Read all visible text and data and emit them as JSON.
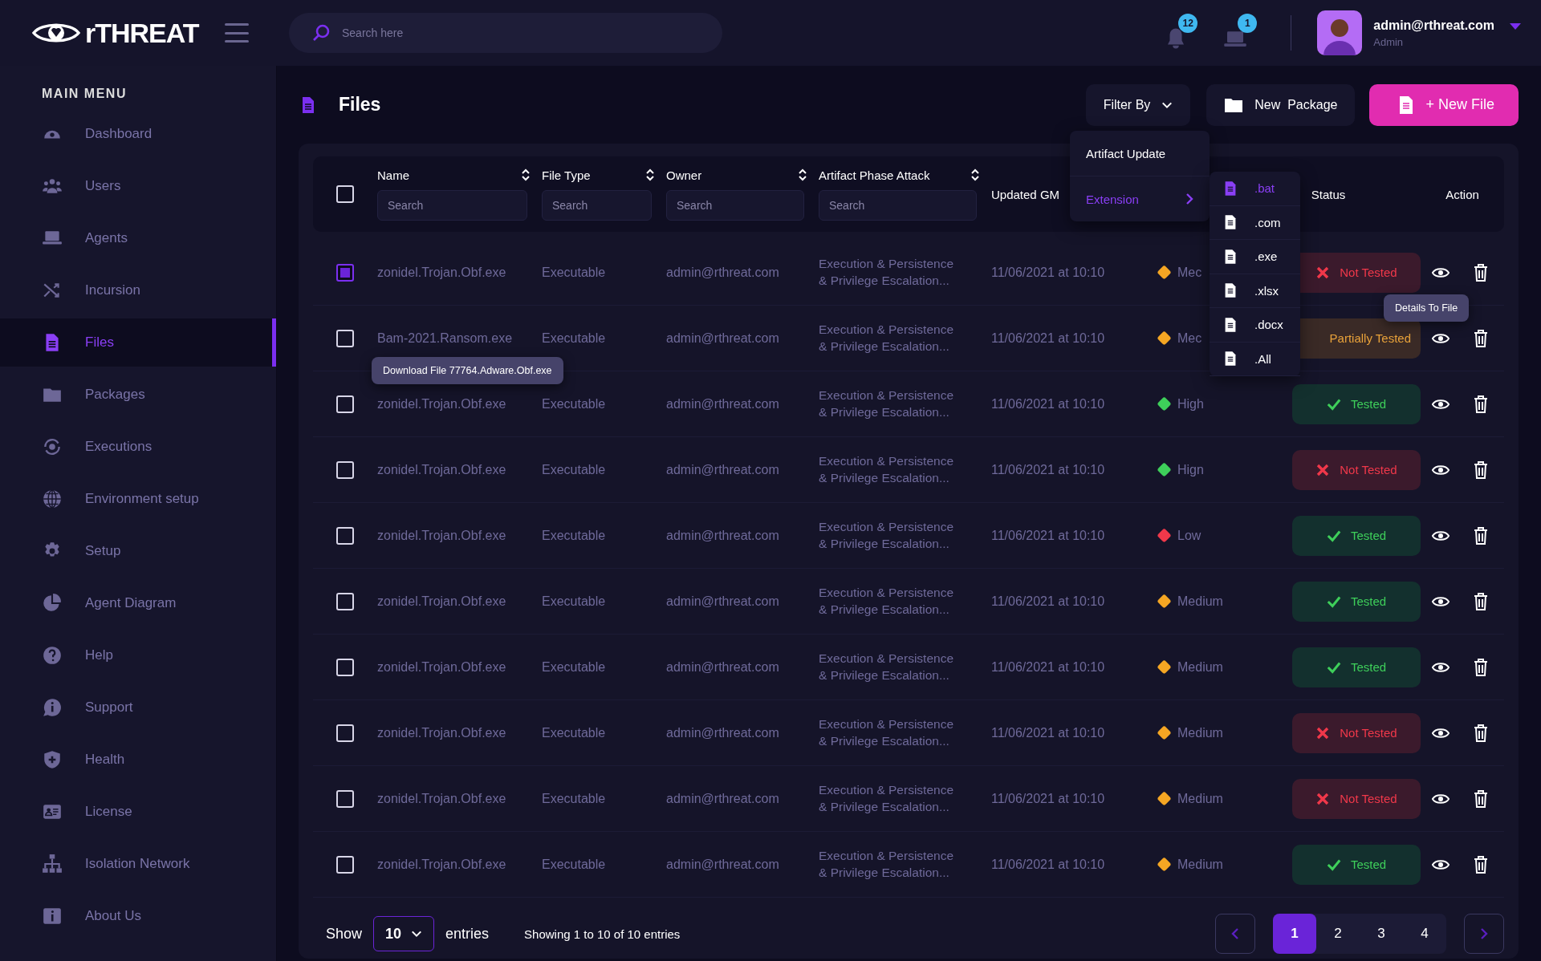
{
  "header": {
    "logo": "rTHREAT",
    "search_placeholder": "Search here",
    "badges": [
      {
        "count": "12"
      },
      {
        "count": "1"
      }
    ],
    "user": {
      "email": "admin@rthreat.com",
      "role": "Admin"
    }
  },
  "sidebar": {
    "title": "MAIN MENU",
    "items": [
      {
        "label": "Dashboard",
        "selected": false
      },
      {
        "label": "Users",
        "selected": false
      },
      {
        "label": "Agents",
        "selected": false
      },
      {
        "label": "Incursion",
        "selected": false
      },
      {
        "label": "Files",
        "selected": true
      },
      {
        "label": "Packages",
        "selected": false
      },
      {
        "label": "Executions",
        "selected": false
      },
      {
        "label": "Environment setup",
        "selected": false
      },
      {
        "label": "Setup",
        "selected": false
      },
      {
        "label": "Agent Diagram",
        "selected": false
      },
      {
        "label": "Help",
        "selected": false
      },
      {
        "label": "Support",
        "selected": false
      },
      {
        "label": "Health",
        "selected": false
      },
      {
        "label": "License",
        "selected": false
      },
      {
        "label": "Isolation Network",
        "selected": false
      },
      {
        "label": "About Us",
        "selected": false
      }
    ]
  },
  "page": {
    "title": "Files",
    "filter_button": "Filter By",
    "new_package_button": "New  Package",
    "new_file_button": "+ New File"
  },
  "filter_menu": {
    "items": [
      {
        "label": "Artifact Update",
        "selected": false
      },
      {
        "label": "Extension",
        "selected": true
      }
    ]
  },
  "extension_menu": {
    "items": [
      {
        "label": ".bat",
        "selected": true
      },
      {
        "label": ".com",
        "selected": false
      },
      {
        "label": ".exe",
        "selected": false
      },
      {
        "label": ".xlsx",
        "selected": false
      },
      {
        "label": ".docx",
        "selected": false
      },
      {
        "label": ".All",
        "selected": false
      }
    ]
  },
  "table": {
    "select_all_checked": false,
    "columns": [
      {
        "label": "Name",
        "kind": "sortable",
        "search_placeholder": "Search"
      },
      {
        "label": "File Type",
        "kind": "sortable",
        "search_placeholder": "Search"
      },
      {
        "label": "Owner",
        "kind": "sortable",
        "search_placeholder": "Search"
      },
      {
        "label": "Artifact Phase Attack",
        "kind": "sortable",
        "search_placeholder": "Search"
      },
      {
        "label": "Updated GM",
        "kind": "plain"
      },
      {
        "label": "Status",
        "kind": "plain"
      },
      {
        "label": "Action",
        "kind": "plain"
      }
    ],
    "rows": [
      {
        "checked": true,
        "name": "zonidel.Trojan.Obf.exe",
        "file_type": "Executable",
        "owner": "admin@rthreat.com",
        "phase": [
          "Execution & Persistence",
          "& Privilege Escalation..."
        ],
        "updated": "11/06/2021 at 10:10",
        "priority": {
          "label": "Mec",
          "color": "#f5a623"
        },
        "status": {
          "label": "Not Tested",
          "kind": "not_tested"
        }
      },
      {
        "checked": false,
        "name": "Bam-2021.Ransom.exe",
        "file_type": "Executable",
        "owner": "admin@rthreat.com",
        "phase": [
          "Execution & Persistence",
          "& Privilege Escalation..."
        ],
        "updated": "11/06/2021 at 10:10",
        "priority": {
          "label": "Mec",
          "color": "#f5a623"
        },
        "status": {
          "label": "Partially Tested",
          "kind": "partial"
        }
      },
      {
        "checked": false,
        "name": "zonidel.Trojan.Obf.exe",
        "file_type": "Executable",
        "owner": "admin@rthreat.com",
        "phase": [
          "Execution & Persistence",
          "& Privilege Escalation..."
        ],
        "updated": "11/06/2021 at 10:10",
        "priority": {
          "label": "High",
          "color": "#3ecf5a"
        },
        "status": {
          "label": "Tested",
          "kind": "tested"
        }
      },
      {
        "checked": false,
        "name": "zonidel.Trojan.Obf.exe",
        "file_type": "Executable",
        "owner": "admin@rthreat.com",
        "phase": [
          "Execution & Persistence",
          "& Privilege Escalation..."
        ],
        "updated": "11/06/2021 at 10:10",
        "priority": {
          "label": "Hign",
          "color": "#3ecf5a"
        },
        "status": {
          "label": "Not Tested",
          "kind": "not_tested"
        }
      },
      {
        "checked": false,
        "name": "zonidel.Trojan.Obf.exe",
        "file_type": "Executable",
        "owner": "admin@rthreat.com",
        "phase": [
          "Execution & Persistence",
          "& Privilege Escalation..."
        ],
        "updated": "11/06/2021 at 10:10",
        "priority": {
          "label": "Low",
          "color": "#f0384a"
        },
        "status": {
          "label": "Tested",
          "kind": "tested"
        }
      },
      {
        "checked": false,
        "name": "zonidel.Trojan.Obf.exe",
        "file_type": "Executable",
        "owner": "admin@rthreat.com",
        "phase": [
          "Execution & Persistence",
          "& Privilege Escalation..."
        ],
        "updated": "11/06/2021 at 10:10",
        "priority": {
          "label": "Medium",
          "color": "#f5a623"
        },
        "status": {
          "label": "Tested",
          "kind": "tested"
        }
      },
      {
        "checked": false,
        "name": "zonidel.Trojan.Obf.exe",
        "file_type": "Executable",
        "owner": "admin@rthreat.com",
        "phase": [
          "Execution & Persistence",
          "& Privilege Escalation..."
        ],
        "updated": "11/06/2021 at 10:10",
        "priority": {
          "label": "Medium",
          "color": "#f5a623"
        },
        "status": {
          "label": "Tested",
          "kind": "tested"
        }
      },
      {
        "checked": false,
        "name": "zonidel.Trojan.Obf.exe",
        "file_type": "Executable",
        "owner": "admin@rthreat.com",
        "phase": [
          "Execution & Persistence",
          "& Privilege Escalation..."
        ],
        "updated": "11/06/2021 at 10:10",
        "priority": {
          "label": "Medium",
          "color": "#f5a623"
        },
        "status": {
          "label": "Not Tested",
          "kind": "not_tested"
        }
      },
      {
        "checked": false,
        "name": "zonidel.Trojan.Obf.exe",
        "file_type": "Executable",
        "owner": "admin@rthreat.com",
        "phase": [
          "Execution & Persistence",
          "& Privilege Escalation..."
        ],
        "updated": "11/06/2021 at 10:10",
        "priority": {
          "label": "Medium",
          "color": "#f5a623"
        },
        "status": {
          "label": "Not Tested",
          "kind": "not_tested"
        }
      },
      {
        "checked": false,
        "name": "zonidel.Trojan.Obf.exe",
        "file_type": "Executable",
        "owner": "admin@rthreat.com",
        "phase": [
          "Execution & Persistence",
          "& Privilege Escalation..."
        ],
        "updated": "11/06/2021 at 10:10",
        "priority": {
          "label": "Medium",
          "color": "#f5a623"
        },
        "status": {
          "label": "Tested",
          "kind": "tested"
        }
      }
    ]
  },
  "tooltips": {
    "download": "Download File 77764.Adware.Obf.exe",
    "details": "Details To File"
  },
  "footer": {
    "show_label": "Show",
    "page_size": "10",
    "entries_label": "entries",
    "summary": "Showing 1 to 10 of 10 entries",
    "pages": [
      {
        "label": "1",
        "selected": true
      },
      {
        "label": "2",
        "selected": false
      },
      {
        "label": "3",
        "selected": false
      },
      {
        "label": "4",
        "selected": false
      }
    ]
  }
}
